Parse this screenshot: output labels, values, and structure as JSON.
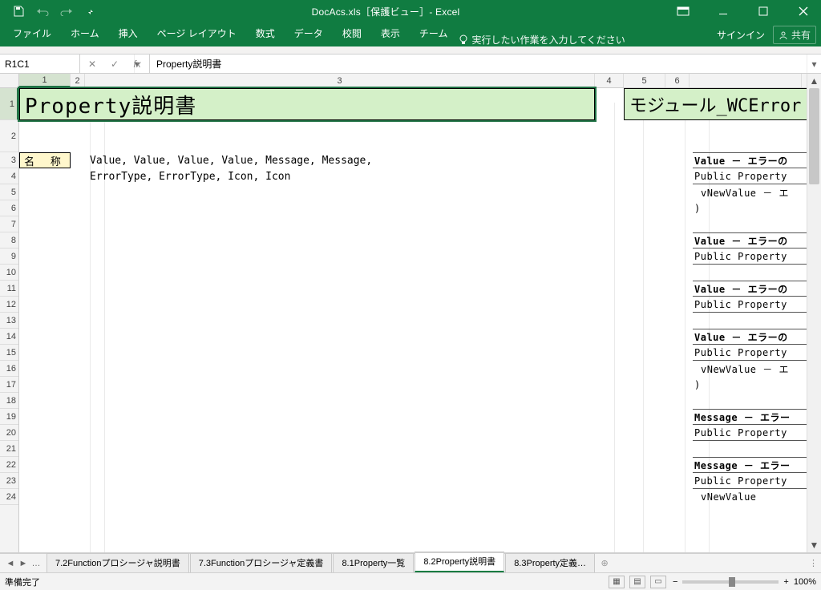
{
  "titlebar": {
    "app_title": "DocAcs.xls［保護ビュー］- Excel"
  },
  "ribbon": {
    "tabs": [
      "ファイル",
      "ホーム",
      "挿入",
      "ページ レイアウト",
      "数式",
      "データ",
      "校閲",
      "表示",
      "チーム"
    ],
    "tellme_placeholder": "実行したい作業を入力してください",
    "signin": "サインイン",
    "share": "共有"
  },
  "formula_bar": {
    "namebox": "R1C1",
    "formula": "Property説明書"
  },
  "columns": [
    "1",
    "2",
    "3",
    "4",
    "5",
    "6"
  ],
  "rows_visible": 24,
  "sheet": {
    "title_cell": "Property説明書",
    "module_cell": "モジュール_WCError",
    "label_cell": "名 称",
    "r3_text": "Value, Value, Value, Value, Message, Message,",
    "r4_text": "ErrorType, ErrorType, Icon, Icon"
  },
  "right_frags": [
    {
      "a": "Value － エラーの",
      "b": "Public Property",
      "c": " vNewValue  － エ",
      "d": ")"
    },
    {
      "a": "Value － エラーの",
      "b": "Public Property"
    },
    {
      "a": "Value － エラーの",
      "b": "Public Property"
    },
    {
      "a": "Value － エラーの",
      "b": "Public Property",
      "c": " vNewValue  － エ",
      "d": ")"
    },
    {
      "a": "Message － エラー",
      "b": "Public Property"
    },
    {
      "a": "Message － エラー",
      "b": "Public Property",
      "c": " vNewValue"
    }
  ],
  "sheet_tabs": {
    "items": [
      "7.2Functionプロシージャ説明書",
      "7.3Functionプロシージャ定義書",
      "8.1Property一覧",
      "8.2Property説明書",
      "8.3Property定義… "
    ],
    "active_index": 3,
    "prefix": "…"
  },
  "statusbar": {
    "ready": "準備完了",
    "zoom": "100%"
  }
}
